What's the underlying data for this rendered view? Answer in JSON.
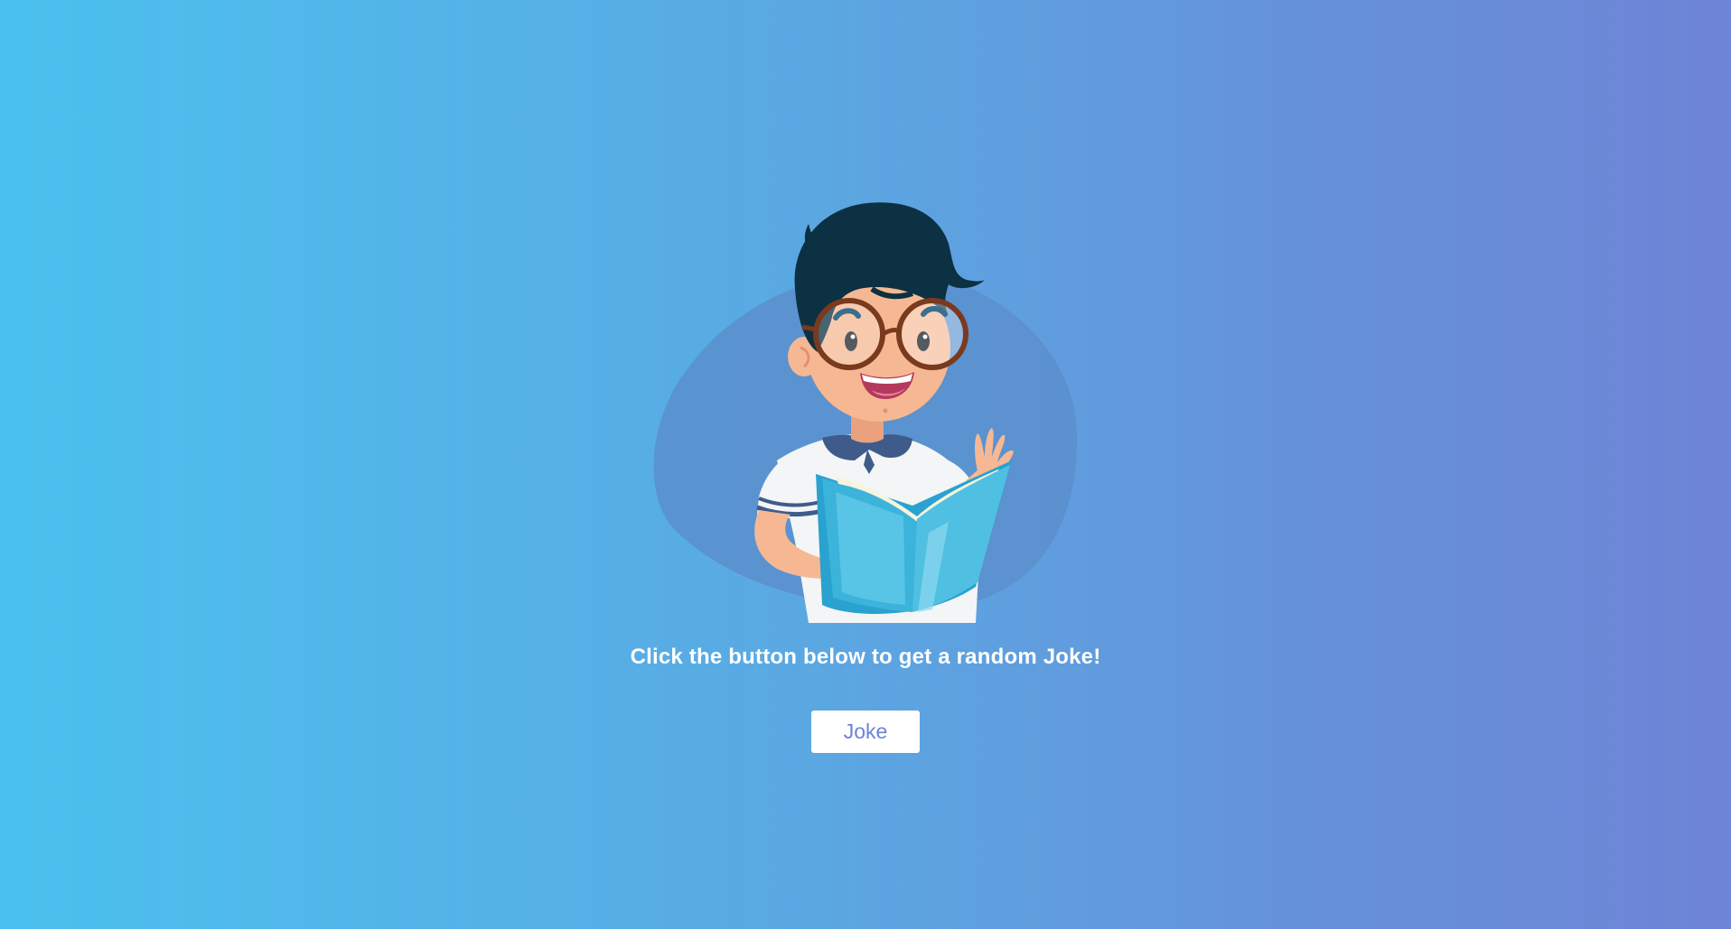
{
  "prompt_text": "Click the button below to get a random Joke!",
  "joke_button_label": "Joke",
  "colors": {
    "gradient_start": "#4ac1ee",
    "gradient_end": "#6e84d6",
    "button_text": "#6a84d6",
    "hair": "#0b3142",
    "skin": "#f6b892",
    "book": "#3bb3db"
  },
  "illustration": {
    "icon": "boy-reading-book-illustration"
  }
}
